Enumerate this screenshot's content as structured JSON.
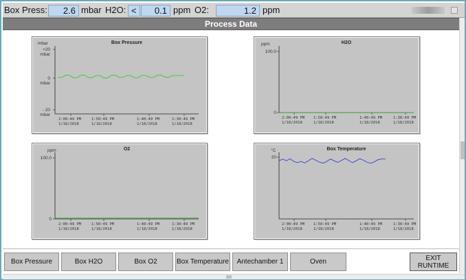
{
  "status": {
    "box_press_label": "Box Press:",
    "box_press_value": "2.6",
    "box_press_unit": "mbar",
    "h2o_label": "H2O:",
    "h2o_lt": "<",
    "h2o_value": "0.1",
    "h2o_unit": "ppm",
    "o2_label": "O2:",
    "o2_value": "1.2",
    "o2_unit": "ppm"
  },
  "title": "Process Data",
  "charts": [
    {
      "title": "Box Pressure",
      "unit": "mbar",
      "y_labels": [
        {
          "top": "+20",
          "bottom": "mbar"
        },
        {
          "top": "0",
          "bottom": "mbar"
        },
        {
          "top": "- 20",
          "bottom": "mbar"
        }
      ],
      "x_labels": [
        {
          "time": "2:00:49 PM",
          "date": "1/18/2018"
        },
        {
          "time": "1:50:49 PM",
          "date": "1/18/2018"
        },
        {
          "time": "1:40:49 PM",
          "date": "1/18/2018"
        },
        {
          "time": "1:30:49 PM",
          "date": "1/18/2018"
        }
      ],
      "line_color": "#33cc33"
    },
    {
      "title": "H2O",
      "unit": "ppm",
      "y_labels": [
        {
          "top": "100.0",
          "bottom": ""
        },
        {
          "top": "0",
          "bottom": ""
        }
      ],
      "x_labels": [
        {
          "time": "2:00:49 PM",
          "date": "1/18/2018"
        },
        {
          "time": "1:50:49 PM",
          "date": "1/18/2018"
        },
        {
          "time": "1:40:49 PM",
          "date": "1/18/2018"
        },
        {
          "time": "1:30:49 PM",
          "date": "1/18/2018"
        }
      ],
      "line_color": "#33aa33"
    },
    {
      "title": "O2",
      "unit": "ppm",
      "y_labels": [
        {
          "top": "100.0",
          "bottom": ""
        },
        {
          "top": "0",
          "bottom": ""
        }
      ],
      "x_labels": [
        {
          "time": "2:00:49 PM",
          "date": "1/18/2018"
        },
        {
          "time": "1:50:49 PM",
          "date": "1/18/2018"
        },
        {
          "time": "1:40:49 PM",
          "date": "1/18/2018"
        },
        {
          "time": "1:30:49 PM",
          "date": "1/18/2018"
        }
      ],
      "line_color": "#33aa33"
    },
    {
      "title": "Box Temperature",
      "unit": "°C",
      "y_labels": [
        {
          "top": "20",
          "bottom": ""
        }
      ],
      "x_labels": [
        {
          "time": "2:00:49 PM",
          "date": "1/18/2018"
        },
        {
          "time": "1:50:49 PM",
          "date": "1/18/2018"
        },
        {
          "time": "1:40:49 PM",
          "date": "1/18/2018"
        },
        {
          "time": "1:30:49 PM",
          "date": "1/18/2018"
        }
      ],
      "line_color": "#3344cc"
    }
  ],
  "buttons": {
    "box_pressure": "Box Pressure",
    "box_h2o": "Box H2O",
    "box_o2": "Box O2",
    "box_temperature": "Box Temperature",
    "antechamber": "Antechamber 1",
    "oven": "Oven",
    "exit": "EXIT\nRUNTIME"
  },
  "chart_data": [
    {
      "type": "line",
      "title": "Box Pressure",
      "ylabel": "mbar",
      "ylim": [
        -20,
        20
      ],
      "x": [
        "2:00:49 PM",
        "1:50:49 PM",
        "1:40:49 PM",
        "1:30:49 PM"
      ],
      "series": [
        {
          "values": [
            1.5,
            1.5,
            2.8,
            2.8,
            1.3,
            1.3,
            2.8,
            2.8,
            1.4,
            1.4,
            2.6,
            2.6,
            1.2,
            1.2,
            2.8,
            2.8,
            1.5,
            1.5,
            2.6,
            2.6,
            1.3,
            1.3,
            2.8,
            2.6,
            1.5,
            1.5,
            2.8,
            2.8,
            1.6,
            1.6,
            2.6,
            2.6,
            2.6,
            2.6
          ]
        }
      ]
    },
    {
      "type": "line",
      "title": "H2O",
      "ylabel": "ppm",
      "ylim": [
        0,
        100
      ],
      "x": [
        "2:00:49 PM",
        "1:50:49 PM",
        "1:40:49 PM",
        "1:30:49 PM"
      ],
      "series": [
        {
          "values": [
            0.1,
            0.1,
            0.1,
            0.1,
            0.1,
            0.1,
            0.1,
            0.1
          ]
        }
      ]
    },
    {
      "type": "line",
      "title": "O2",
      "ylabel": "ppm",
      "ylim": [
        0,
        100
      ],
      "x": [
        "2:00:49 PM",
        "1:50:49 PM",
        "1:40:49 PM",
        "1:30:49 PM"
      ],
      "series": [
        {
          "values": [
            1.2,
            1.2,
            1.2,
            1.2,
            1.2,
            1.2,
            1.2,
            1.2
          ]
        }
      ]
    },
    {
      "type": "line",
      "title": "Box Temperature",
      "ylabel": "°C",
      "ylim": [
        0,
        22
      ],
      "x": [
        "2:00:49 PM",
        "1:50:49 PM",
        "1:40:49 PM",
        "1:30:49 PM"
      ],
      "series": [
        {
          "values": [
            19.2,
            19.8,
            19.2,
            19.9,
            19.0,
            18.6,
            19.0,
            18.5,
            19.2,
            20.0,
            19.4,
            18.8,
            18.4,
            19.0,
            19.8,
            19.2,
            18.7,
            19.3,
            20.0,
            19.3,
            18.6,
            19.2,
            19.9,
            19.4,
            18.7,
            18.4,
            18.9,
            19.6,
            19.8,
            19.8
          ]
        }
      ]
    }
  ]
}
